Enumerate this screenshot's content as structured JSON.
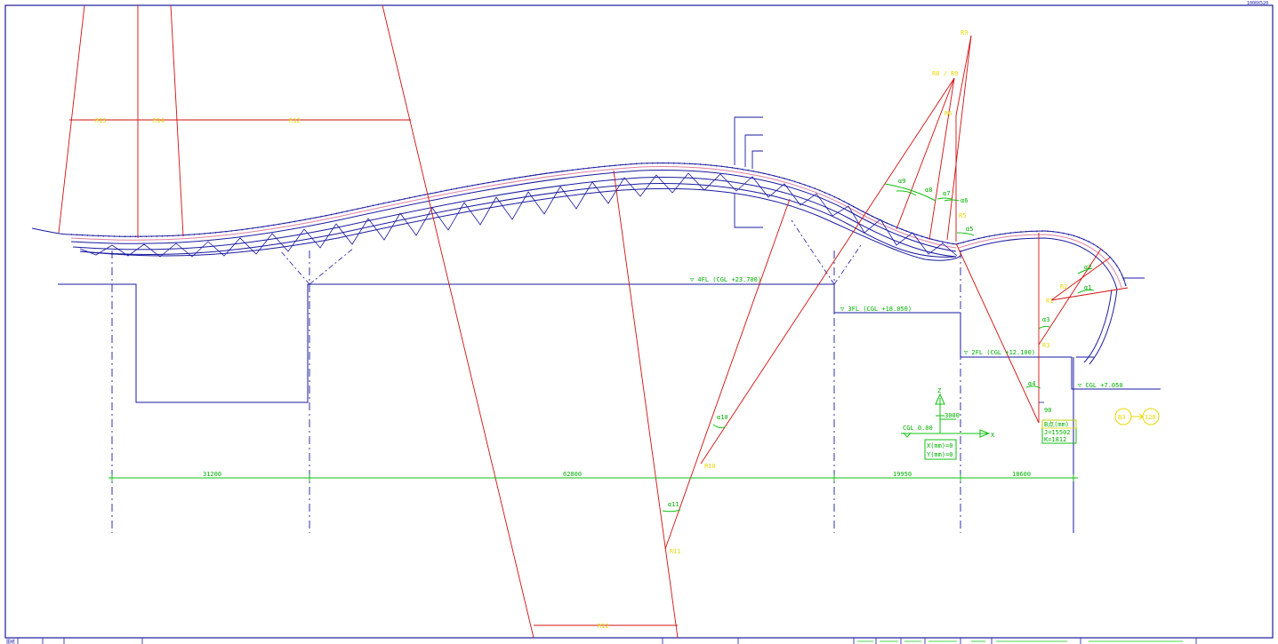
{
  "sheet": {
    "size_label": "1000X520",
    "corner_label": "图纸"
  },
  "colors": {
    "frame": "#1a1aa0",
    "structure": "#1a1aa0",
    "radius": "#d01010",
    "dimension": "#10c010",
    "label": "#e8d800",
    "pink": "#e080a0"
  },
  "radius_labels": {
    "r13": "R13",
    "r14": "R14",
    "r12_top": "R12",
    "r12_bottom": "R12",
    "r11": "R11",
    "r10": "R10",
    "r9": "R9",
    "r8_r9": "R8 / R9",
    "r6": "R6",
    "r5": "R5",
    "r1": "R1",
    "r2": "R2",
    "r3": "R3"
  },
  "angle_labels": {
    "a1": "α1",
    "a2": "α2",
    "a3": "α3",
    "a4": "α4",
    "a5": "α5",
    "a6": "α6",
    "a7": "α7",
    "a8": "α8",
    "a9": "α9",
    "a10": "α10",
    "a11": "α11"
  },
  "levels": {
    "fl4": "▽ 4FL (CGL +23.700)",
    "fl3": "▽ 3FL (CGL +18.050)",
    "fl2": "▽ 2FL (CGL +12.100)",
    "cgl": "▽ CGL   +7.050"
  },
  "dimensions": {
    "d1": "31200",
    "d2": "62800",
    "d3": "19950",
    "d4": "18600"
  },
  "origin": {
    "cgl_label": "CGL 0.00",
    "z_axis": "Z",
    "x_axis": "X",
    "height_label": "3000",
    "coord_x": "X(mm)=0",
    "coord_y": "Y(mm)=0"
  },
  "section_box": {
    "line1": "B点(mm)",
    "line2": "J=15502",
    "line3": "K=1812",
    "angle_tag": "90"
  },
  "ref_tag": {
    "left": "B3",
    "right": "128"
  }
}
